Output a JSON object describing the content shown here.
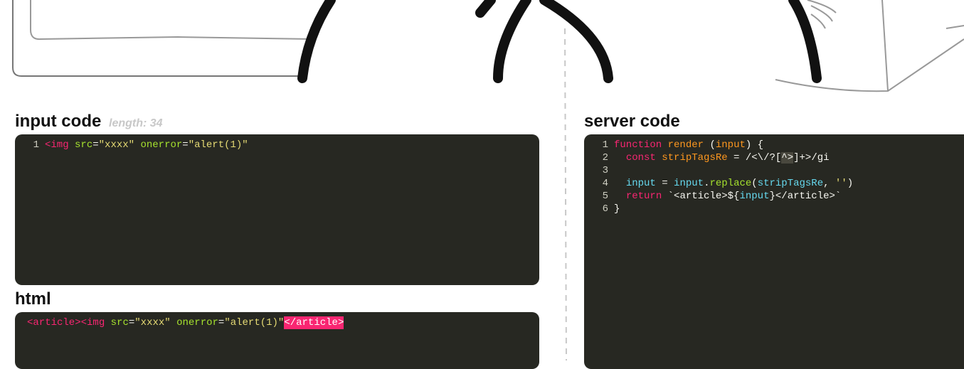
{
  "input_panel": {
    "title": "input code",
    "length_label": "length: 34",
    "lines": [
      {
        "num": "1",
        "tokens": [
          {
            "t": "<img",
            "c": "tag"
          },
          {
            "t": " ",
            "c": "white"
          },
          {
            "t": "src",
            "c": "attr"
          },
          {
            "t": "=",
            "c": "white"
          },
          {
            "t": "\"xxxx\"",
            "c": "str"
          },
          {
            "t": " ",
            "c": "white"
          },
          {
            "t": "onerror",
            "c": "attr"
          },
          {
            "t": "=",
            "c": "white"
          },
          {
            "t": "\"alert(1)\"",
            "c": "str"
          }
        ]
      }
    ]
  },
  "html_panel": {
    "title": "html",
    "tokens": [
      {
        "t": "<article>",
        "c": "tag"
      },
      {
        "t": "<img",
        "c": "tag"
      },
      {
        "t": " ",
        "c": "white"
      },
      {
        "t": "src",
        "c": "attr"
      },
      {
        "t": "=",
        "c": "white"
      },
      {
        "t": "\"xxxx\"",
        "c": "str"
      },
      {
        "t": " ",
        "c": "white"
      },
      {
        "t": "onerror",
        "c": "attr"
      },
      {
        "t": "=",
        "c": "white"
      },
      {
        "t": "\"alert(1)\"",
        "c": "str"
      },
      {
        "t": "</article>",
        "c": "tag-hl"
      }
    ]
  },
  "server_panel": {
    "title": "server code",
    "lines": [
      {
        "num": "1",
        "tokens": [
          {
            "t": "function",
            "c": "kw"
          },
          {
            "t": " ",
            "c": "white"
          },
          {
            "t": "render",
            "c": "fn"
          },
          {
            "t": " (",
            "c": "white"
          },
          {
            "t": "input",
            "c": "param"
          },
          {
            "t": ") {",
            "c": "white"
          }
        ]
      },
      {
        "num": "2",
        "tokens": [
          {
            "t": "  ",
            "c": "white"
          },
          {
            "t": "const",
            "c": "kw"
          },
          {
            "t": " ",
            "c": "white"
          },
          {
            "t": "stripTagsRe",
            "c": "fn"
          },
          {
            "t": " = ",
            "c": "white"
          },
          {
            "t": "/<\\/?[",
            "c": "white"
          },
          {
            "t": "^>",
            "c": "match-hl"
          },
          {
            "t": "]+>/gi",
            "c": "white"
          }
        ]
      },
      {
        "num": "3",
        "tokens": []
      },
      {
        "num": "4",
        "tokens": [
          {
            "t": "  ",
            "c": "white"
          },
          {
            "t": "input",
            "c": "ident"
          },
          {
            "t": " = ",
            "c": "white"
          },
          {
            "t": "input",
            "c": "ident"
          },
          {
            "t": ".",
            "c": "white"
          },
          {
            "t": "replace",
            "c": "attr"
          },
          {
            "t": "(",
            "c": "white"
          },
          {
            "t": "stripTagsRe",
            "c": "ident"
          },
          {
            "t": ", ",
            "c": "white"
          },
          {
            "t": "''",
            "c": "str"
          },
          {
            "t": ")",
            "c": "white"
          }
        ]
      },
      {
        "num": "5",
        "tokens": [
          {
            "t": "  ",
            "c": "white"
          },
          {
            "t": "return",
            "c": "kw"
          },
          {
            "t": " ",
            "c": "white"
          },
          {
            "t": "`<article>${",
            "c": "white"
          },
          {
            "t": "input",
            "c": "ident"
          },
          {
            "t": "}</article>`",
            "c": "white"
          }
        ]
      },
      {
        "num": "6",
        "tokens": [
          {
            "t": "}",
            "c": "white"
          }
        ]
      }
    ]
  }
}
